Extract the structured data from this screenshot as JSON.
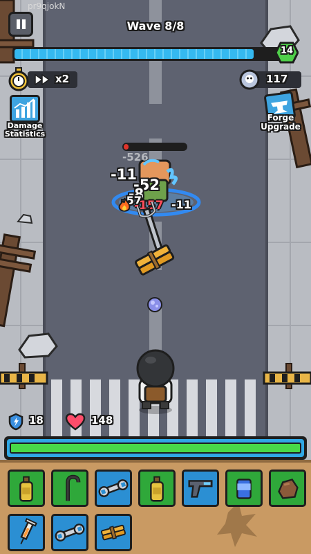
{
  "watermark": "pr9qjokN",
  "hud": {
    "wave_label": "Wave 8/8",
    "wave_progress": 0.9,
    "level": "14",
    "speed_label": "x2",
    "coins": "117",
    "damage_statistics_label": "Damage\nStatistics",
    "forge_upgrade_label": "Forge\nUpgrade"
  },
  "player": {
    "shield": "18",
    "health": "148",
    "energy": 1.0
  },
  "enemy": {
    "health_fraction": 0.08
  },
  "damage_numbers": [
    "-526",
    "-11",
    "-52",
    "-8",
    "-57",
    "-157",
    "-11"
  ],
  "inventory": {
    "row1": [
      {
        "icon": "bottle-icon",
        "rarity": "green"
      },
      {
        "icon": "cane-icon",
        "rarity": "green"
      },
      {
        "icon": "wrench-icon",
        "rarity": "blue"
      },
      {
        "icon": "bottle-icon",
        "rarity": "green"
      },
      {
        "icon": "pistol-icon",
        "rarity": "blue"
      },
      {
        "icon": "can-icon",
        "rarity": "green"
      },
      {
        "icon": "rock-icon",
        "rarity": "green"
      }
    ],
    "row2": [
      {
        "icon": "syringe-icon",
        "rarity": "blue"
      },
      {
        "icon": "wrench-icon",
        "rarity": "blue"
      },
      {
        "icon": "dynamite-icon",
        "rarity": "blue"
      }
    ]
  },
  "colors": {
    "road": "#5e6270",
    "sidewalk": "#b9bcc2",
    "wave_bar": "#35b9f0",
    "energy_bar": "#48d948",
    "inventory_bg": "#c99a63"
  }
}
